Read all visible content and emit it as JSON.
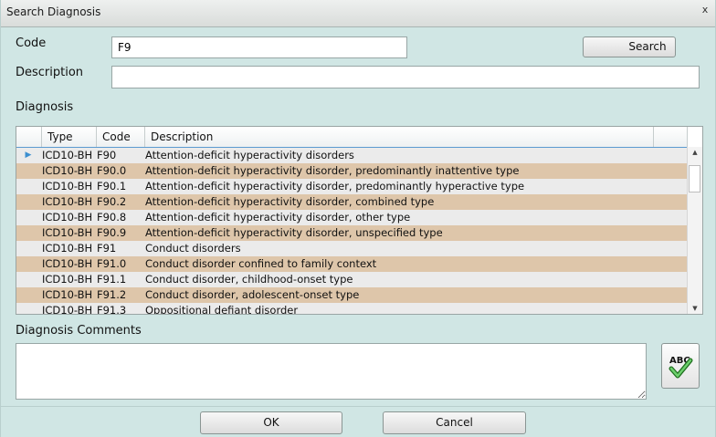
{
  "window": {
    "title": "Search Diagnosis",
    "close_glyph": "x"
  },
  "form": {
    "code_label": "Code",
    "code_value": "F9",
    "description_label": "Description",
    "description_value": "",
    "search_button": "Search",
    "diagnosis_label": "Diagnosis"
  },
  "grid": {
    "columns": [
      "Type",
      "Code",
      "Description"
    ],
    "selected_indicator": "▶",
    "rows": [
      {
        "type": "ICD10-BH",
        "code": "F90",
        "description": "Attention-deficit hyperactivity disorders"
      },
      {
        "type": "ICD10-BH",
        "code": "F90.0",
        "description": "Attention-deficit hyperactivity disorder, predominantly inattentive type"
      },
      {
        "type": "ICD10-BH",
        "code": "F90.1",
        "description": "Attention-deficit hyperactivity disorder, predominantly hyperactive type"
      },
      {
        "type": "ICD10-BH",
        "code": "F90.2",
        "description": "Attention-deficit hyperactivity disorder, combined type"
      },
      {
        "type": "ICD10-BH",
        "code": "F90.8",
        "description": "Attention-deficit hyperactivity disorder, other type"
      },
      {
        "type": "ICD10-BH",
        "code": "F90.9",
        "description": "Attention-deficit hyperactivity disorder, unspecified type"
      },
      {
        "type": "ICD10-BH",
        "code": "F91",
        "description": "Conduct disorders"
      },
      {
        "type": "ICD10-BH",
        "code": "F91.0",
        "description": "Conduct disorder confined to family context"
      },
      {
        "type": "ICD10-BH",
        "code": "F91.1",
        "description": "Conduct disorder, childhood-onset type"
      },
      {
        "type": "ICD10-BH",
        "code": "F91.2",
        "description": "Conduct disorder, adolescent-onset type"
      },
      {
        "type": "ICD10-BH",
        "code": "F91.3",
        "description": "Oppositional defiant disorder"
      }
    ],
    "row_colors": {
      "even": "#ebebeb",
      "odd": "#dec6aa"
    }
  },
  "comments": {
    "label": "Diagnosis Comments",
    "value": ""
  },
  "spellcheck": {
    "icon": "spellcheck-icon",
    "text": "ABC"
  },
  "buttons": {
    "ok": "OK",
    "cancel": "Cancel"
  },
  "colors": {
    "background": "#d0e6e4",
    "header_accent": "#5c9bd0",
    "check_green": "#3aa53a"
  }
}
